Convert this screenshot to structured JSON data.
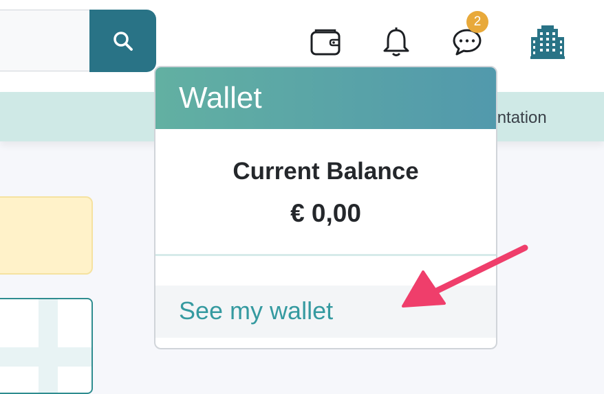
{
  "header": {
    "search": {
      "placeholder": ""
    },
    "icons": [
      "search-icon",
      "wallet-icon",
      "bell-icon",
      "chat-icon",
      "building-icon"
    ],
    "messages_badge": "2"
  },
  "navbar": {
    "partial_item": "nentation"
  },
  "wallet_dropdown": {
    "title": "Wallet",
    "balance_label": "Current Balance",
    "balance_value": "€ 0,00",
    "link": "See my wallet"
  },
  "colors": {
    "primary": "#297386",
    "header_gradient_start": "#62b0a2",
    "header_gradient_end": "#5299ac",
    "link": "#359aa0",
    "badge": "#e8a93a",
    "arrow": "#ef3e6b"
  }
}
